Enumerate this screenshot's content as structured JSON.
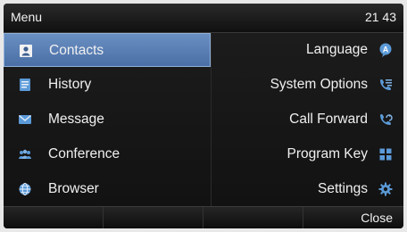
{
  "statusbar": {
    "title": "Menu",
    "time": "21 43"
  },
  "menu": {
    "left": [
      {
        "label": "Contacts",
        "icon": "contacts-icon",
        "selected": true
      },
      {
        "label": "History",
        "icon": "history-icon",
        "selected": false
      },
      {
        "label": "Message",
        "icon": "message-icon",
        "selected": false
      },
      {
        "label": "Conference",
        "icon": "conference-icon",
        "selected": false
      },
      {
        "label": "Browser",
        "icon": "browser-icon",
        "selected": false
      }
    ],
    "right": [
      {
        "label": "Language",
        "icon": "language-icon"
      },
      {
        "label": "System Options",
        "icon": "system-options-icon"
      },
      {
        "label": "Call Forward",
        "icon": "call-forward-icon"
      },
      {
        "label": "Program Key",
        "icon": "program-key-icon"
      },
      {
        "label": "Settings",
        "icon": "settings-icon"
      }
    ]
  },
  "softkeys": {
    "close_label": "Close"
  },
  "colors": {
    "selected_bg": "#5a80b8",
    "icon_blue": "#5b9ad8",
    "text": "#f0f0f0",
    "background": "#101010"
  }
}
